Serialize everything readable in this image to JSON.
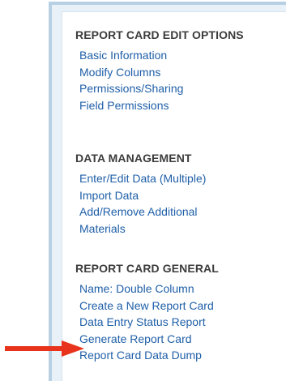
{
  "sections": [
    {
      "title": "REPORT CARD EDIT OPTIONS",
      "items": [
        "Basic Information",
        "Modify Columns",
        "Permissions/Sharing",
        "Field Permissions"
      ]
    },
    {
      "title": "DATA MANAGEMENT",
      "items": [
        "Enter/Edit Data (Multiple)",
        "Import Data",
        "Add/Remove Additional Materials"
      ]
    },
    {
      "title": "REPORT CARD GENERAL",
      "items": [
        "Name: Double Column",
        "Create a New Report Card",
        "Data Entry Status Report",
        "Generate Report Card",
        "Report Card Data Dump"
      ]
    }
  ],
  "colors": {
    "link": "#1f5fa8",
    "heading": "#3c3c3c",
    "panel_border": "#b8d0e4",
    "arrow": "#e8341c"
  },
  "annotation": {
    "arrow_icon": "red-arrow-right-icon",
    "points_to": "Generate Report Card"
  }
}
